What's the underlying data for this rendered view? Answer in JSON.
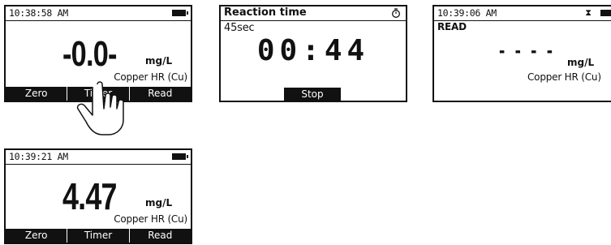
{
  "screen1": {
    "time": "10:38:58 AM",
    "reading": "-0.0-",
    "unit": "mg/L",
    "method": "Copper HR (Cu)",
    "softkeys": [
      "Zero",
      "Timer",
      "Read"
    ]
  },
  "screen2": {
    "title": "Reaction time",
    "duration": "45sec",
    "countdown": "00:44",
    "stop_label": "Stop"
  },
  "screen3": {
    "time": "10:39:06 AM",
    "status": "READ",
    "reading": "- - - -",
    "unit": "mg/L",
    "method": "Copper HR (Cu)"
  },
  "screen4": {
    "time": "10:39:21 AM",
    "reading": "4.47",
    "unit": "mg/L",
    "method": "Copper HR (Cu)",
    "softkeys": [
      "Zero",
      "Timer",
      "Read"
    ]
  },
  "icons": {
    "battery": "battery-icon",
    "stopwatch": "stopwatch-icon",
    "hourglass": "hourglass-icon",
    "hand": "pointing-hand-icon"
  }
}
